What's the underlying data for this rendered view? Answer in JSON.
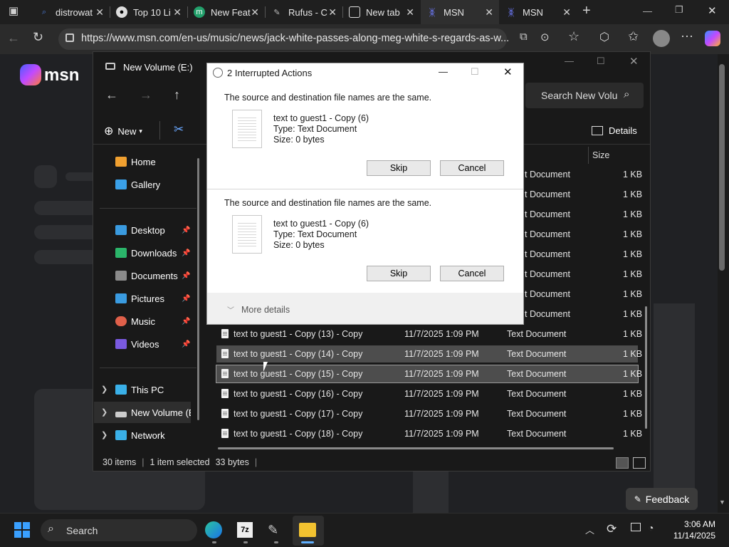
{
  "browser": {
    "tabs": [
      {
        "title": "distrowat",
        "icon": "search-icon",
        "color": "#4a7bd8"
      },
      {
        "title": "Top 10 Li",
        "icon": "linux-tux-icon",
        "color": "#dddddd"
      },
      {
        "title": "New Feat",
        "icon": "m-green-icon",
        "color": "#22a06b"
      },
      {
        "title": "Rufus - C",
        "icon": "usb-drive-icon",
        "color": "#bbbbbb"
      },
      {
        "title": "New tab",
        "icon": "new-tab-icon",
        "color": "#dddddd"
      },
      {
        "title": "MSN",
        "icon": "msn-butterfly-icon",
        "color": "#6f7cff"
      },
      {
        "title": "MSN",
        "icon": "msn-butterfly-icon",
        "color": "#6f7cff"
      }
    ],
    "url": "https://www.msn.com/en-us/music/news/jack-white-passes-along-meg-white-s-regards-as-w..."
  },
  "msn": {
    "logo_text": "msn",
    "feedback_label": "Feedback"
  },
  "explorer": {
    "title": "New Volume (E:)",
    "search_placeholder": "Search New Volu",
    "new_label": "New",
    "details_label": "Details",
    "size_header": "Size",
    "nav": [
      {
        "label": "Home",
        "icon": "home-icon",
        "color": "#f0a030"
      },
      {
        "label": "Gallery",
        "icon": "gallery-icon",
        "color": "#3aa0e8"
      },
      {
        "label": "Desktop",
        "icon": "desktop-icon",
        "color": "#3a9be0"
      },
      {
        "label": "Downloads",
        "icon": "download-icon",
        "color": "#2bb56a"
      },
      {
        "label": "Documents",
        "icon": "documents-icon",
        "color": "#8a8a8a"
      },
      {
        "label": "Pictures",
        "icon": "pictures-icon",
        "color": "#3a9be0"
      },
      {
        "label": "Music",
        "icon": "music-icon",
        "color": "#e0604a"
      },
      {
        "label": "Videos",
        "icon": "videos-icon",
        "color": "#7a5ae0"
      },
      {
        "label": "This PC",
        "icon": "pc-icon",
        "color": "#3ab0e8"
      },
      {
        "label": "New Volume (E:",
        "icon": "drive-icon",
        "color": "#cccccc"
      },
      {
        "label": "Network",
        "icon": "network-icon",
        "color": "#3ab0e8"
      }
    ],
    "partial_rows": [
      {
        "type": "t Document",
        "size": "1 KB"
      },
      {
        "type": "t Document",
        "size": "1 KB"
      },
      {
        "type": "t Document",
        "size": "1 KB"
      },
      {
        "type": "t Document",
        "size": "1 KB"
      },
      {
        "type": "t Document",
        "size": "1 KB"
      },
      {
        "type": "t Document",
        "size": "1 KB"
      },
      {
        "type": "t Document",
        "size": "1 KB"
      },
      {
        "type": "t Document",
        "size": "1 KB"
      }
    ],
    "files": [
      {
        "name": "text to guest1 - Copy (13) - Copy",
        "date": "11/7/2025 1:09 PM",
        "type": "Text Document",
        "size": "1 KB"
      },
      {
        "name": "text to guest1 - Copy (14) - Copy",
        "date": "11/7/2025 1:09 PM",
        "type": "Text Document",
        "size": "1 KB"
      },
      {
        "name": "text to guest1 - Copy (15) - Copy",
        "date": "11/7/2025 1:09 PM",
        "type": "Text Document",
        "size": "1 KB"
      },
      {
        "name": "text to guest1 - Copy (16) - Copy",
        "date": "11/7/2025 1:09 PM",
        "type": "Text Document",
        "size": "1 KB"
      },
      {
        "name": "text to guest1 - Copy (17) - Copy",
        "date": "11/7/2025 1:09 PM",
        "type": "Text Document",
        "size": "1 KB"
      },
      {
        "name": "text to guest1 - Copy (18) - Copy",
        "date": "11/7/2025 1:09 PM",
        "type": "Text Document",
        "size": "1 KB"
      }
    ],
    "status": {
      "items": "30 items",
      "selected": "1 item selected",
      "size": "33 bytes"
    }
  },
  "dialog": {
    "title": "2 Interrupted Actions",
    "sections": [
      {
        "message": "The source and destination file names are the same.",
        "filename": "text to guest1 - Copy (6)",
        "type": "Type: Text Document",
        "size": "Size: 0 bytes",
        "skip": "Skip",
        "cancel": "Cancel"
      },
      {
        "message": "The source and destination file names are the same.",
        "filename": "text to guest1 - Copy (6)",
        "type": "Type: Text Document",
        "size": "Size: 0 bytes",
        "skip": "Skip",
        "cancel": "Cancel"
      }
    ],
    "more_details": "More details"
  },
  "taskbar": {
    "search_label": "Search",
    "time": "3:06 AM",
    "date": "11/14/2025"
  }
}
